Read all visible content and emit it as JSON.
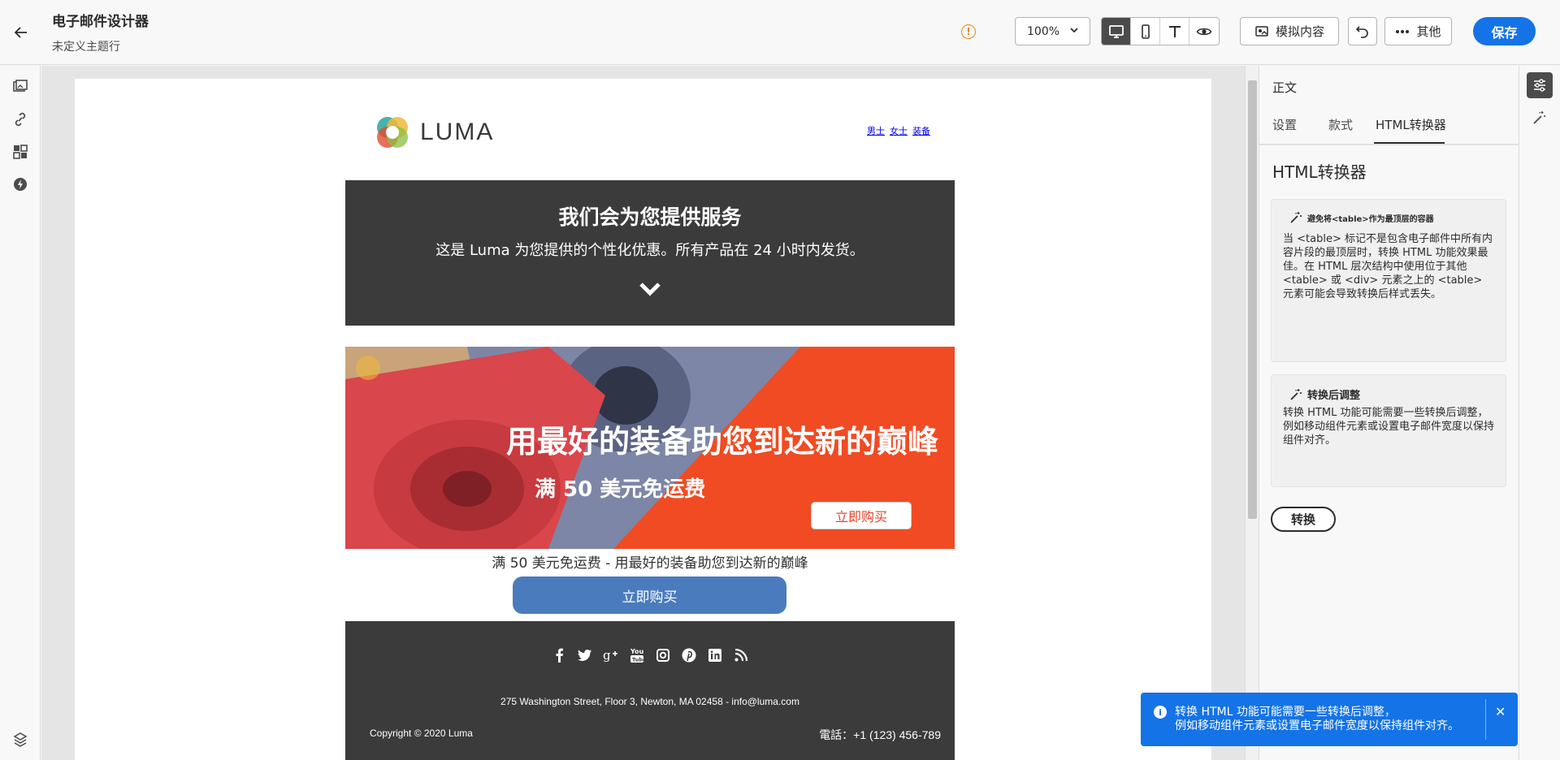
{
  "header": {
    "title": "电子邮件设计器",
    "subtitle": "未定义主题行",
    "zoom": "100%",
    "simulate_label": "模拟内容",
    "more_label": "其他",
    "save_label": "保存"
  },
  "email": {
    "logo_text": "LUMA",
    "nav": [
      "男士",
      "女士",
      "装备"
    ],
    "hero_title": "我们会为您提供服务",
    "hero_subtitle": "这是 Luma 为您提供的个性化优惠。所有产品在 24 小时内发货。",
    "banner_title": "用最好的装备助您到达新的巅峰",
    "banner_subtitle": "满 50 美元免运费",
    "banner_button": "立即购买",
    "caption": "满 50 美元免运费 - 用最好的装备助您到达新的巅峰",
    "cta_button": "立即购买",
    "address": "275 Washington Street, Floor 3, Newton, MA 02458 - info@luma.com",
    "copyright": "Copyright © 2020 Luma",
    "phone": "電話：+1 (123) 456-789",
    "social_icons": [
      "facebook-icon",
      "twitter-icon",
      "google-plus-icon",
      "youtube-icon",
      "instagram-icon",
      "pinterest-icon",
      "linkedin-icon",
      "rss-icon"
    ]
  },
  "panel": {
    "heading": "正文",
    "tabs": [
      "设置",
      "款式",
      "HTML转换器"
    ],
    "active_tab": "HTML转换器",
    "title": "HTML转换器",
    "card1_title": "避免将<table>作为最顶层的容器",
    "card1_body": "当 <table> 标记不是包含电子邮件中所有内容片段的最顶层时，转换 HTML 功能效果最佳。在 HTML 层次结构中使用位于其他 <table> 或 <div> 元素之上的 <table> 元素可能会导致转换后样式丢失。",
    "card2_title": "转换后调整",
    "card2_body": "转换 HTML 功能可能需要一些转换后调整，例如移动组件元素或设置电子邮件宽度以保持组件对齐。",
    "convert_button": "转换"
  },
  "toast": {
    "line1": "转换 HTML 功能可能需要一些转换后调整，",
    "line2": "例如移动组件元素或设置电子邮件宽度以保持组件对齐。"
  },
  "colors": {
    "accent": "#1473e6",
    "dark_block": "#3b3b3b",
    "banner_orange": "#e8442a",
    "cta_blue": "#4a7bbd"
  }
}
